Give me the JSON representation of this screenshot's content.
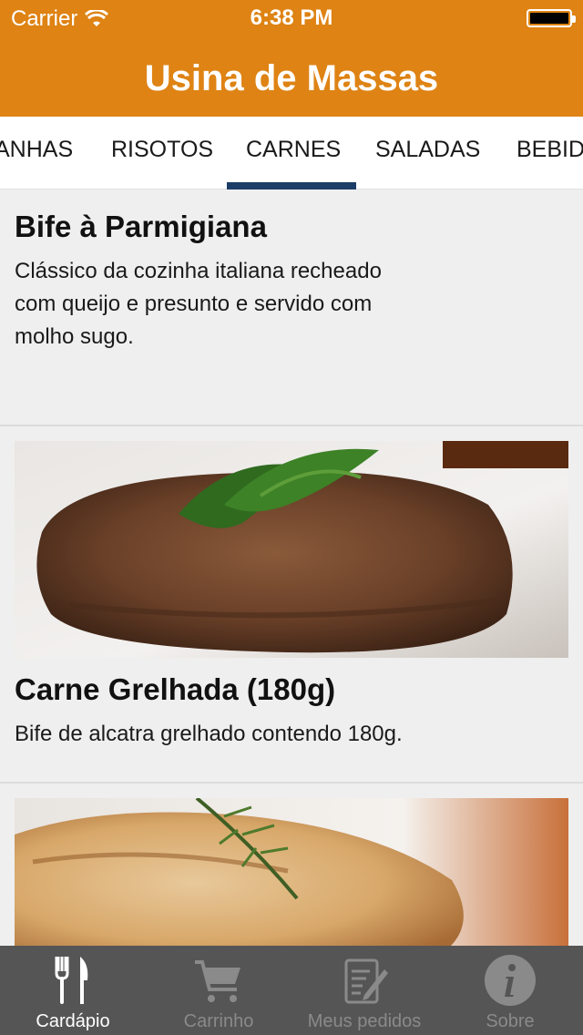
{
  "status": {
    "carrier": "Carrier",
    "time": "6:38 PM"
  },
  "header": {
    "title": "Usina de Massas"
  },
  "category_tabs": [
    "ANHAS",
    "RISOTOS",
    "CARNES",
    "SALADAS",
    "BEBID"
  ],
  "selected_tab": "CARNES",
  "items": [
    {
      "title": "Bife à Parmigiana",
      "description": "Clássico da cozinha italiana recheado com queijo e presunto e servido com molho sugo."
    },
    {
      "title": "Carne Grelhada (180g)",
      "description": "Bife de alcatra grelhado contendo 180g."
    }
  ],
  "tabbar": [
    {
      "label": "Cardápio",
      "icon": "fork-knife-icon",
      "active": true
    },
    {
      "label": "Carrinho",
      "icon": "cart-icon",
      "active": false
    },
    {
      "label": "Meus pedidos",
      "icon": "notepad-pencil-icon",
      "active": false
    },
    {
      "label": "Sobre",
      "icon": "info-icon",
      "active": false
    }
  ],
  "colors": {
    "header": "#de8314",
    "tab_indicator": "#1c3e66",
    "tabbar": "#555555"
  }
}
